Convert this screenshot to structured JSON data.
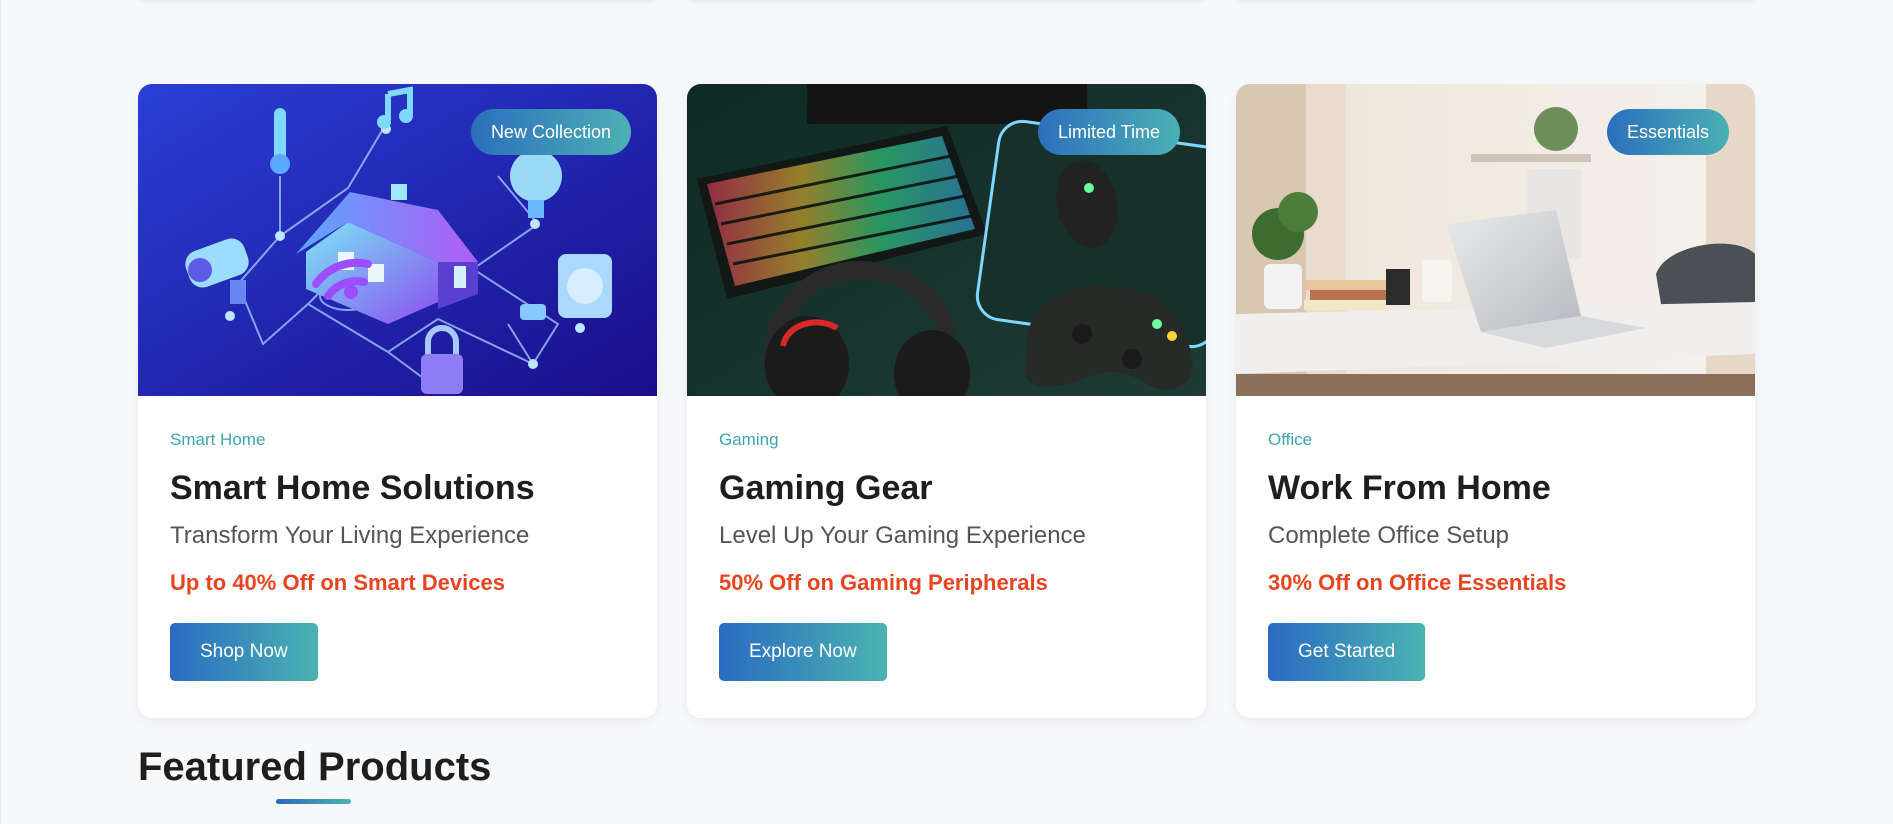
{
  "promo_cards": [
    {
      "badge": "New Collection",
      "category": "Smart Home",
      "title": "Smart Home Solutions",
      "subtitle": "Transform Your Living Experience",
      "offer": "Up to 40% Off on Smart Devices",
      "cta": "Shop Now",
      "image_icon": "smart-home-illustration"
    },
    {
      "badge": "Limited Time",
      "category": "Gaming",
      "title": "Gaming Gear",
      "subtitle": "Level Up Your Gaming Experience",
      "offer": "50% Off on Gaming Peripherals",
      "cta": "Explore Now",
      "image_icon": "gaming-setup-photo"
    },
    {
      "badge": "Essentials",
      "category": "Office",
      "title": "Work From Home",
      "subtitle": "Complete Office Setup",
      "offer": "30% Off on Office Essentials",
      "cta": "Get Started",
      "image_icon": "home-office-photo"
    }
  ],
  "featured": {
    "title": "Featured Products"
  },
  "colors": {
    "accent_start": "#2a6bc2",
    "accent_end": "#4bb3b2",
    "category_text": "#3ca6b0",
    "offer_text": "#e8441f",
    "page_background": "#f7f8fa"
  }
}
